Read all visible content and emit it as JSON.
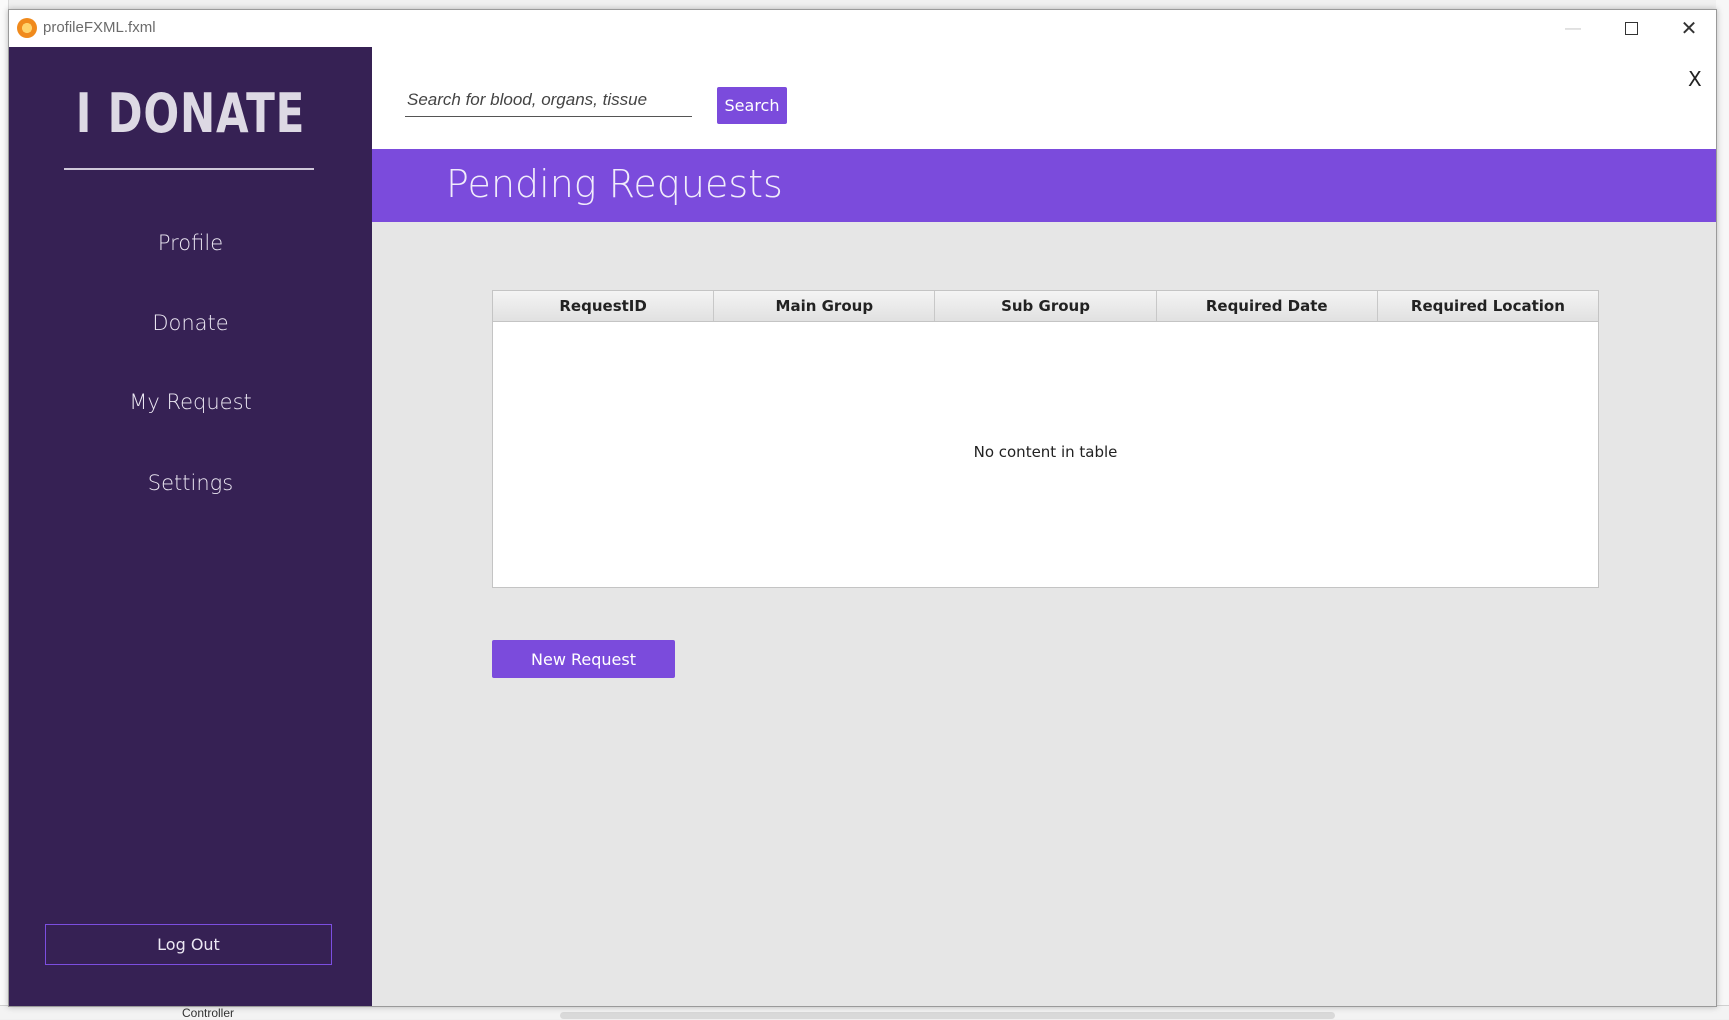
{
  "window": {
    "title": "profileFXML.fxml",
    "minimize_icon": "minimize-icon",
    "maximize_icon": "maximize-icon",
    "close_icon": "close-icon"
  },
  "background": {
    "controller_tab": "Controller"
  },
  "sidebar": {
    "brand": "I DONATE",
    "items": [
      {
        "label": "Profile"
      },
      {
        "label": "Donate"
      },
      {
        "label": "My Request"
      },
      {
        "label": "Settings"
      }
    ],
    "logout_label": "Log Out"
  },
  "topbar": {
    "search_placeholder": "Search for blood, organs, tissue",
    "search_button": "Search",
    "close_label": "X"
  },
  "header": {
    "title": "Pending Requests"
  },
  "table": {
    "columns": [
      "RequestID",
      "Main Group",
      "Sub Group",
      "Required Date",
      "Required Location"
    ],
    "rows": [],
    "empty_message": "No content in table"
  },
  "actions": {
    "new_request": "New Request"
  },
  "colors": {
    "sidebar_bg": "#362154",
    "accent": "#7b4bdc",
    "content_bg": "#e6e6e6"
  }
}
